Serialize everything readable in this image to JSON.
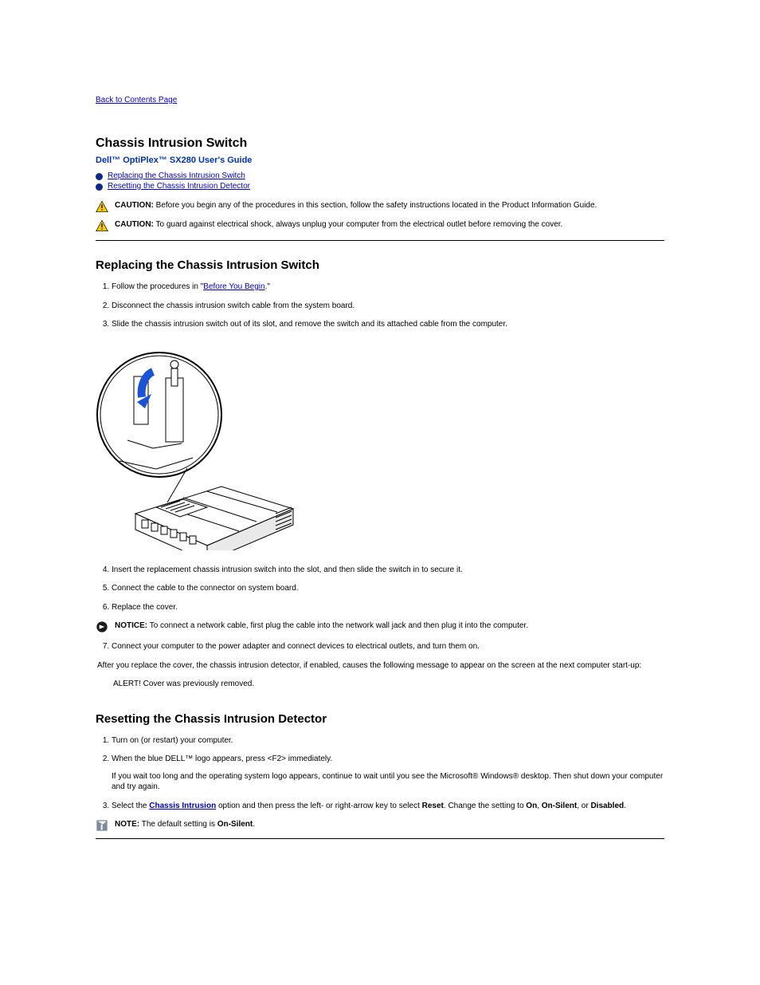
{
  "top_link": "Back to Contents Page",
  "page_title": "Chassis Intrusion Switch",
  "guide_title": "Dell™ OptiPlex™ SX280 User's Guide",
  "bullets": [
    "Replacing the Chassis Intrusion Switch",
    "Resetting the Chassis Intrusion Detector"
  ],
  "caution1": {
    "label": "CAUTION:",
    "text": "Before you begin any of the procedures in this section, follow the safety instructions located in the Product Information Guide."
  },
  "caution2": {
    "label": "CAUTION:",
    "text": "To guard against electrical shock, always unplug your computer from the electrical outlet before removing the cover."
  },
  "proc1_heading": "Replacing the Chassis Intrusion Switch",
  "proc1": {
    "s1_prefix": "Follow the procedures in \"",
    "s1_link": "Before You Begin",
    "s1_suffix": ".\"",
    "s2": "Disconnect the chassis intrusion switch cable from the system board.",
    "s3": "Slide the chassis intrusion switch out of its slot, and remove the switch and its attached cable from the computer.",
    "s4": "Insert the replacement chassis intrusion switch into the slot, and then slide the switch in to secure it.",
    "s5": "Connect the cable to the connector on system board.",
    "s6": "Replace the cover."
  },
  "notice1": {
    "label": "NOTICE:",
    "text": "To connect a network cable, first plug the cable into the network wall jack and then plug it into the computer."
  },
  "proc1_s7": "Connect your computer to the power adapter and connect devices to electrical outlets, and turn them on.",
  "after_cover1": "After you replace the cover, the chassis intrusion detector, if enabled, causes the following message to appear on the screen at the next computer start-up:",
  "alert_msg": "ALERT! Cover was previously removed.",
  "proc2_heading": "Resetting the Chassis Intrusion Detector",
  "proc2": {
    "s1": "Turn on (or restart) your computer.",
    "s2a": "When the blue DELL™ logo appears, press <F2> immediately.",
    "s2b": "If you wait too long and the operating system logo appears, continue to wait until you see the Microsoft® Windows® desktop. Then shut down your computer and try again.",
    "s3_prefix": "Select the ",
    "s3_strong1": "Chassis Intrusion",
    "s3_mid": " option and then press the left- or right-arrow key to select ",
    "s3_strong2": "Reset",
    "s3_suffix": ". Change the setting to ",
    "s3_strong3": "On",
    "s3_or1": ", ",
    "s3_strong4": "On-Silent",
    "s3_or2": ", or ",
    "s3_strong5": "Disabled",
    "s3_dot": "."
  },
  "note1": {
    "label": "NOTE:",
    "text_prefix": "The default setting is ",
    "text_strong": "On-Silent",
    "text_suffix": "."
  }
}
